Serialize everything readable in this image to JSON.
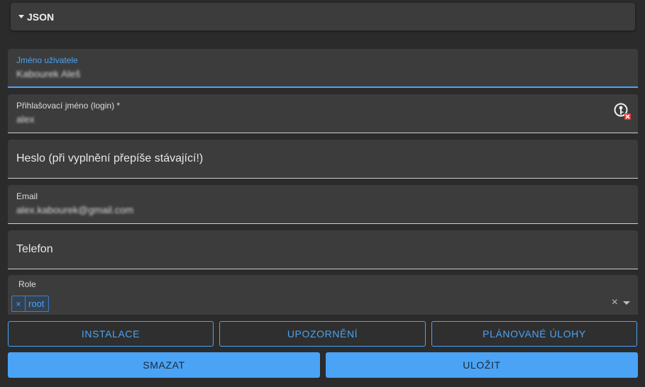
{
  "json_panel": {
    "label": "JSON"
  },
  "fields": {
    "name": {
      "label": "Jméno uživatele",
      "value": "Kabourek Aleš"
    },
    "login": {
      "label": "Přihlašovací jméno (login) *",
      "value": "alex"
    },
    "password": {
      "placeholder": "Heslo (při vyplnění přepíše stávající!)"
    },
    "email": {
      "label": "Email",
      "value": "alex.kabourek@gmail.com"
    },
    "phone": {
      "placeholder": "Telefon"
    }
  },
  "roles": {
    "label": "Role",
    "chips": [
      {
        "remove": "×",
        "label": "root"
      }
    ],
    "clear": "×"
  },
  "buttons": {
    "install": "INSTALACE",
    "notifications": "UPOZORNĚNÍ",
    "scheduled_tasks": "PLÁNOVANÉ ÚLOHY",
    "delete": "SMAZAT",
    "save": "ULOŽIT"
  },
  "colors": {
    "accent": "#4aa3f5",
    "background": "#2b2b2b",
    "field": "#3c3c3c",
    "error": "#e53935"
  },
  "icons": {
    "login_status": "key-remove-icon"
  }
}
